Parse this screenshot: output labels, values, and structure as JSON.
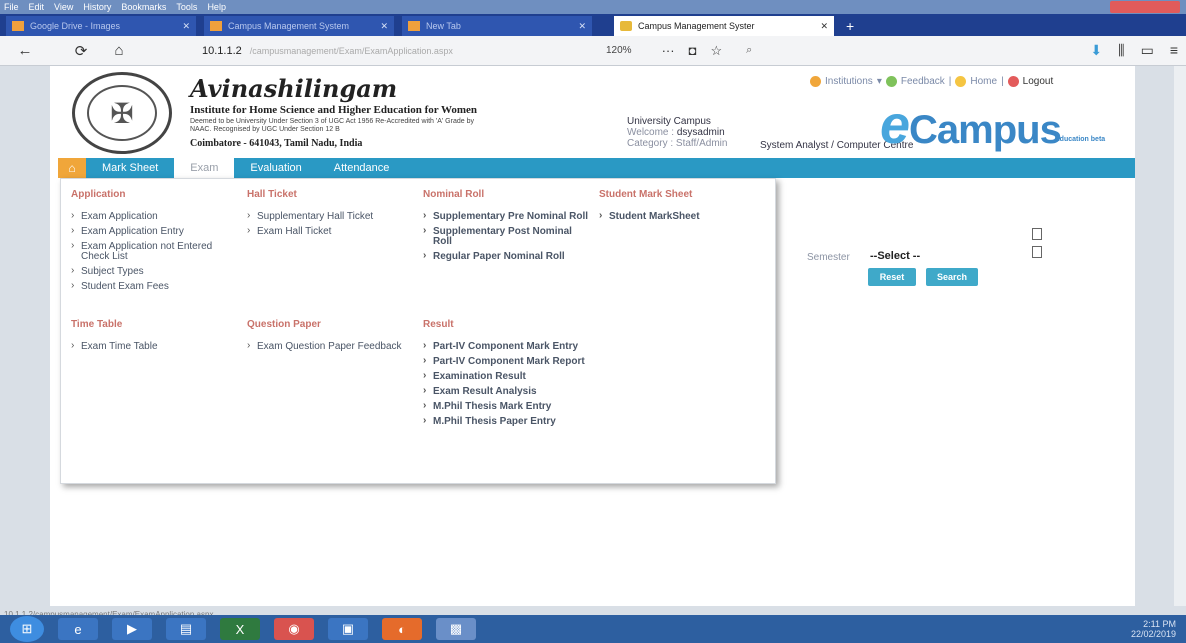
{
  "browser": {
    "menubar": [
      "File",
      "Edit",
      "View",
      "History",
      "Bookmarks",
      "Tools",
      "Help"
    ],
    "tabs": [
      {
        "title": "Google Drive - Images",
        "active": false
      },
      {
        "title": "Campus Management System",
        "active": false
      },
      {
        "title": "New Tab",
        "active": false
      },
      {
        "title": "Campus Management Syster",
        "active": true
      }
    ],
    "new_tab": "+",
    "url": "10.1.1.2",
    "url_rest": "/campusmanagement/Exam/ExamApplication.aspx",
    "zoom": "120%",
    "back_icon": "←",
    "reload_icon": "⟳",
    "home_icon": "⌂"
  },
  "header": {
    "institution_name": "Avinashilingam",
    "institution_sub": "Institute for Home Science and Higher Education for Women",
    "institution_small": "Deemed to be University Under Section 3 of UGC Act 1956 Re-Accredited with 'A' Grade by NAAC. Recognised by UGC Under Section 12 B",
    "institution_location": "Coimbatore - 641043, Tamil Nadu, India",
    "university": "University Campus",
    "welcome_label": "Welcome :",
    "welcome_user": "dsysadmin",
    "category_label": "Category :",
    "category_value": "Staff/Admin",
    "staff_role": "System Analyst / Computer Centre",
    "links": {
      "institutions": "Institutions",
      "feedback": "Feedback",
      "home": "Home",
      "logout": "Logout"
    },
    "brand_e": "e",
    "brand": "Campus",
    "brand_tag": "Education beta"
  },
  "menu": {
    "items": [
      "Mark Sheet",
      "Exam",
      "Evaluation",
      "Attendance"
    ],
    "active_index": 1
  },
  "mega": {
    "columns": [
      {
        "title": "Application",
        "items": [
          "Exam Application",
          "Exam Application Entry",
          "Exam Application not Entered Check List",
          "Subject Types",
          "Student Exam Fees"
        ]
      },
      {
        "title": "Hall Ticket",
        "items": [
          "Supplementary Hall Ticket",
          "Exam Hall Ticket"
        ]
      },
      {
        "title": "Nominal Roll",
        "items": [
          "Supplementary Pre Nominal Roll",
          "Supplementary Post Nominal Roll",
          "Regular Paper Nominal Roll"
        ]
      },
      {
        "title": "Student Mark Sheet",
        "items": [
          "Student MarkSheet"
        ]
      },
      {
        "title": "Time Table",
        "items": [
          "Exam Time Table"
        ]
      },
      {
        "title": "Question Paper",
        "items": [
          "Exam Question Paper Feedback"
        ]
      },
      {
        "title": "Result",
        "items": [
          "Part-IV Component Mark Entry",
          "Part-IV Component Mark Report",
          "Examination Result",
          "Exam Result Analysis",
          "M.Phil Thesis Mark Entry",
          "M.Phil Thesis Paper Entry"
        ]
      }
    ]
  },
  "form": {
    "semester_label": "Semester",
    "semester_value": "--Select --",
    "reset_label": "Reset",
    "search_label": "Search"
  },
  "status_url": "10.1.1.2/campusmanagement/Exam/ExamApplication.aspx",
  "taskbar": {
    "time": "2:11 PM",
    "date": "22/02/2019"
  }
}
